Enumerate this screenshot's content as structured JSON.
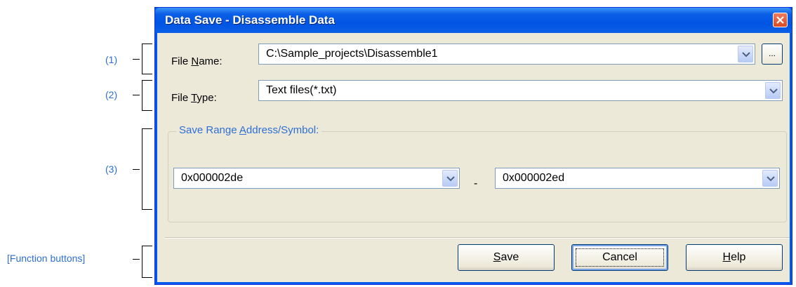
{
  "annotations": {
    "a1": "(1)",
    "a2": "(2)",
    "a3": "(3)",
    "a4": "[Function buttons]"
  },
  "window": {
    "title": "Data Save - Disassemble Data"
  },
  "file_name": {
    "label_pre": "File ",
    "label_key": "N",
    "label_post": "ame:",
    "value": "C:\\Sample_projects\\Disassemble1",
    "browse_label": "..."
  },
  "file_type": {
    "label_pre": "File ",
    "label_key": "T",
    "label_post": "ype:",
    "value": "Text files(*.txt)"
  },
  "save_range": {
    "title_pre": "Save Range ",
    "title_key": "A",
    "title_post": "ddress/Symbol:",
    "start_value": "0x000002de",
    "separator": "-",
    "end_value": "0x000002ed"
  },
  "buttons": {
    "save_key": "S",
    "save_rest": "ave",
    "cancel": "Cancel",
    "help_key": "H",
    "help_rest": "elp"
  },
  "colors": {
    "accent": "#2d6fd6",
    "titlebar": "#0054e3",
    "dialog_bg": "#ece9d8"
  }
}
